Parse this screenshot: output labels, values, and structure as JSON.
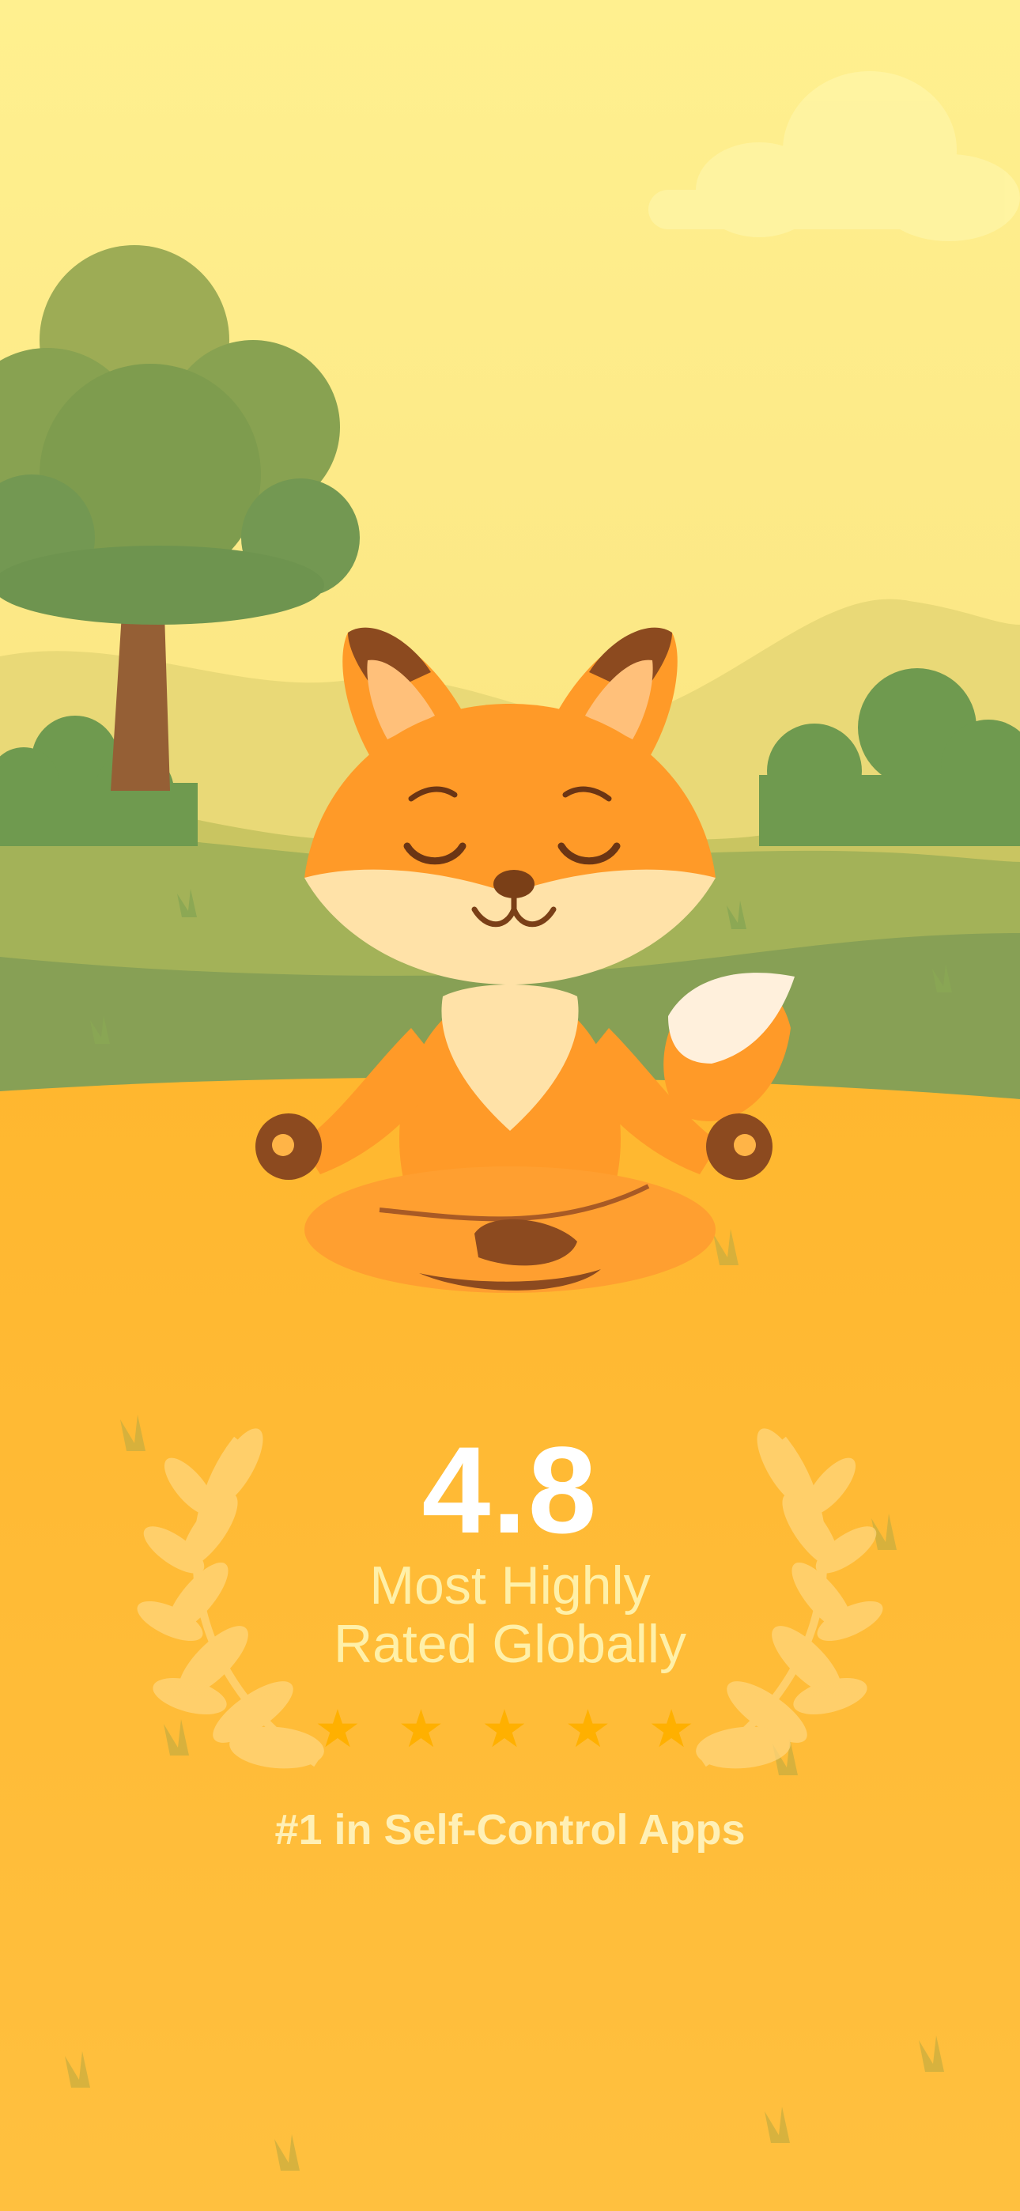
{
  "rating": {
    "score": "4.8",
    "headline_line1": "Most Highly",
    "headline_line2": "Rated Globally",
    "star_glyph": "★",
    "star_count": 5,
    "rank": "#1 in Self-Control Apps"
  },
  "colors": {
    "sky_top": "#fff08f",
    "sky_bottom": "#fbe584",
    "ground": "#ffbd3b",
    "fox_orange": "#ff9a28",
    "fox_cream": "#ffe0a3",
    "fox_brown": "#8c4a1f",
    "star": "#ffb000",
    "text_cream": "#fff0a8"
  },
  "icons": [
    "fox-mascot-icon",
    "tree-icon",
    "laurel-wreath-icon",
    "star-icon",
    "cloud-icon"
  ]
}
